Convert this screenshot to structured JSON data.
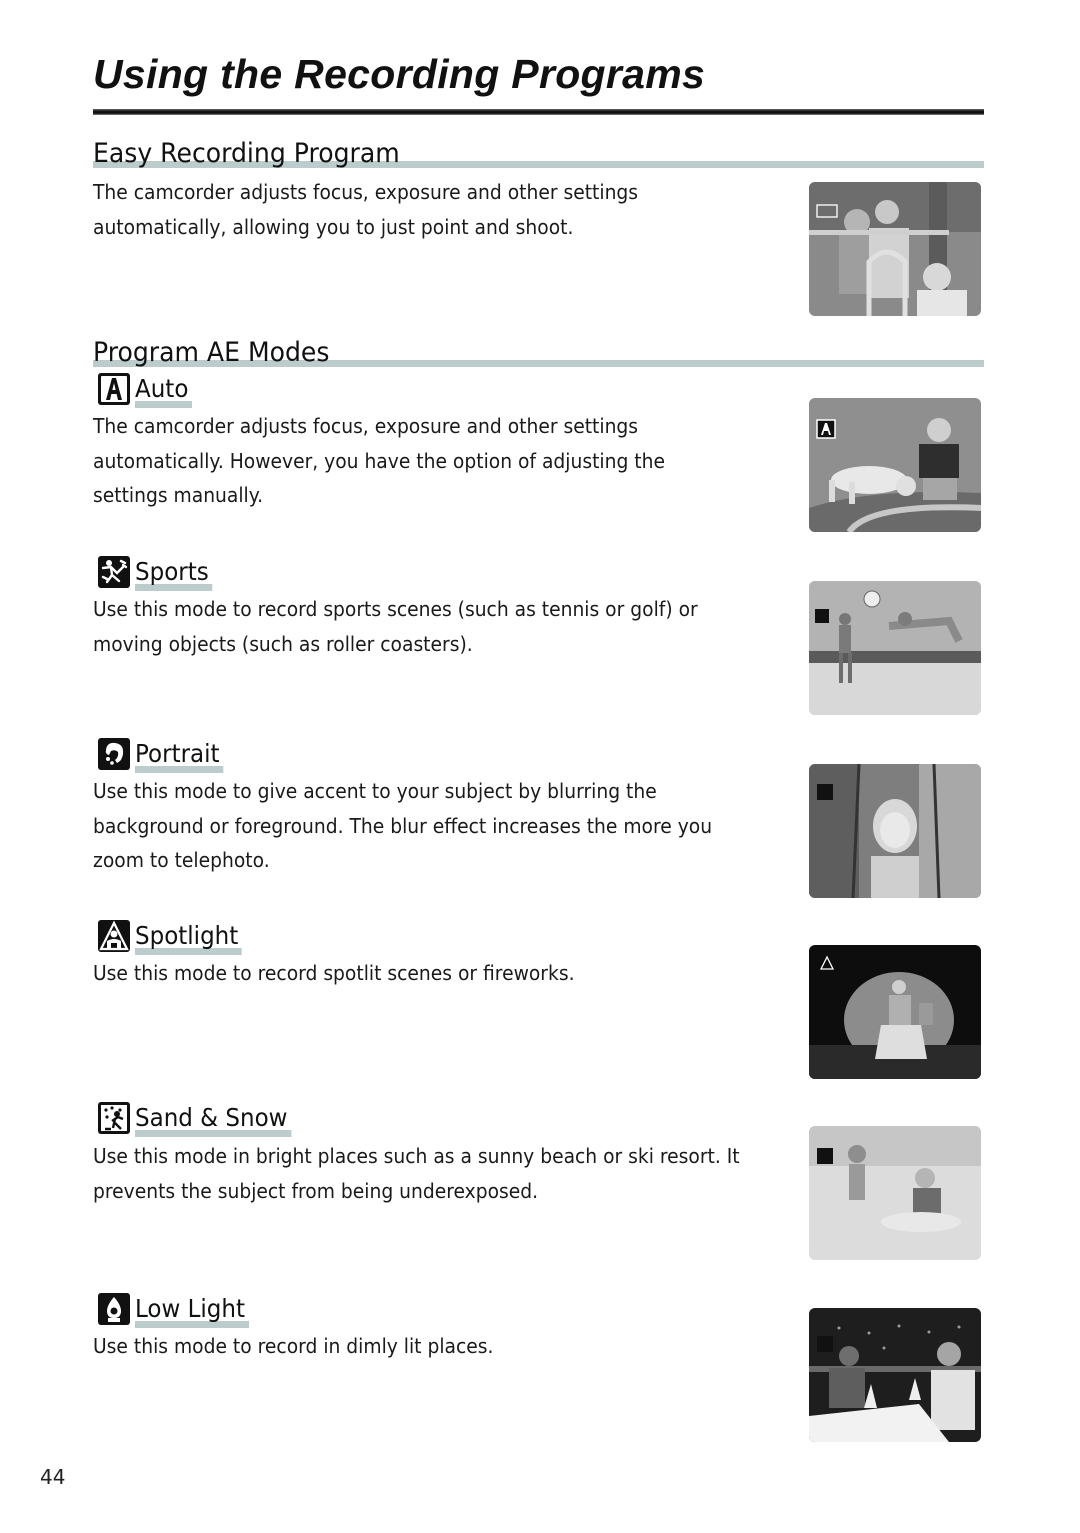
{
  "page": {
    "title": "Using the Recording Programs",
    "page_number": "44"
  },
  "easy": {
    "heading": "Easy Recording Program",
    "text": "The camcorder adjusts focus, exposure and other settings\nautomatically, allowing you to just point and shoot.",
    "photo": "children-on-playground-photo"
  },
  "program_ae": {
    "heading": "Program AE Modes",
    "modes": [
      {
        "icon": "auto-mode-icon",
        "title": "Auto",
        "text": "The camcorder adjusts focus, exposure and other settings\nautomatically. However, you have the option of adjusting the\nsettings manually.",
        "photo": "boy-and-dog-photo"
      },
      {
        "icon": "sports-mode-icon",
        "title": "Sports",
        "text": "Use this mode to record sports scenes (such as tennis or golf) or\nmoving objects (such as roller coasters).",
        "photo": "beach-volleyball-photo"
      },
      {
        "icon": "portrait-mode-icon",
        "title": "Portrait",
        "text": "Use this mode to give accent to your subject by blurring the\nbackground or foreground. The blur effect increases the more you\nzoom to telephoto.",
        "photo": "girl-on-swing-photo"
      },
      {
        "icon": "spotlight-mode-icon",
        "title": "Spotlight",
        "text": "Use this mode to record spotlit scenes or fireworks.",
        "photo": "stage-performer-photo"
      },
      {
        "icon": "sand-snow-mode-icon",
        "title": "Sand & Snow",
        "text": "Use this mode in bright places such as a sunny beach or ski resort. It\nprevents the subject from being underexposed.",
        "photo": "children-in-sand-photo"
      },
      {
        "icon": "low-light-mode-icon",
        "title": "Low Light",
        "text": "Use this mode to record in dimly lit places.",
        "photo": "couple-dining-at-night-photo"
      }
    ]
  },
  "colors": {
    "rule_accent": "#bccbcb",
    "title_rule": "#111111",
    "text": "#1a1a1a"
  }
}
